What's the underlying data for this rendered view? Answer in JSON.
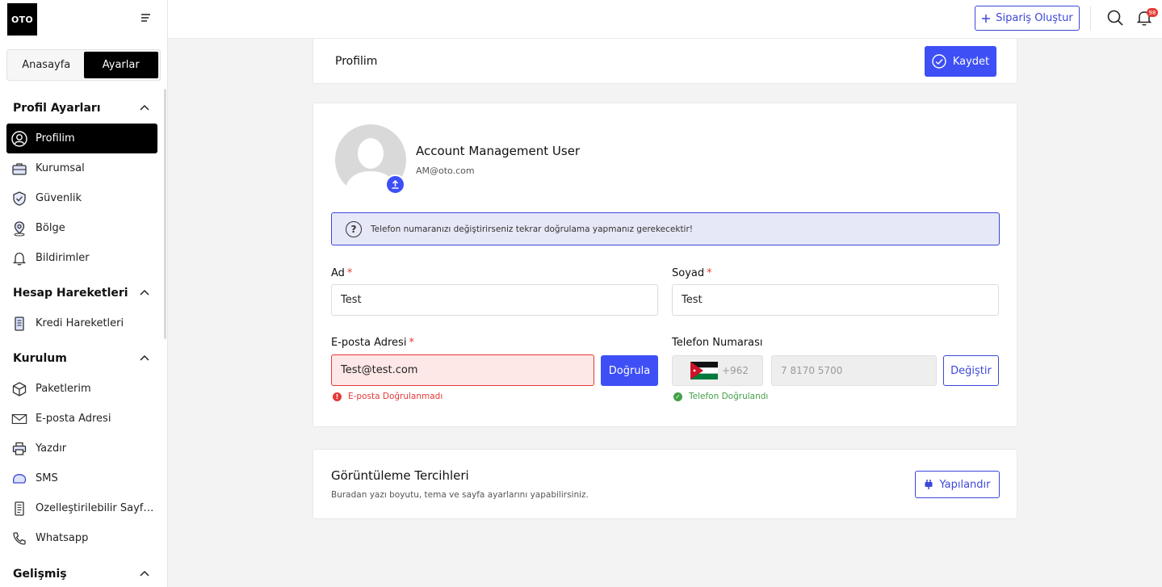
{
  "app": {
    "logo_text": "OTO"
  },
  "segment": {
    "home": "Anasayfa",
    "settings": "Ayarlar"
  },
  "sidebar": {
    "sections": [
      {
        "title": "Profil Ayarları"
      },
      {
        "title": "Hesap Hareketleri"
      },
      {
        "title": "Kurulum"
      },
      {
        "title": "Gelişmiş"
      }
    ],
    "items": [
      {
        "label": "Profilim",
        "icon": "user-circle-icon"
      },
      {
        "label": "Kurumsal",
        "icon": "briefcase-icon"
      },
      {
        "label": "Güvenlik",
        "icon": "shield-icon"
      },
      {
        "label": "Bölge",
        "icon": "location-pin-icon"
      },
      {
        "label": "Bildirimler",
        "icon": "bell-icon"
      },
      {
        "label": "Kredi Hareketleri",
        "icon": "receipt-icon"
      },
      {
        "label": "Paketlerim",
        "icon": "package-icon"
      },
      {
        "label": "E-posta Adresi",
        "icon": "envelope-icon"
      },
      {
        "label": "Yazdır",
        "icon": "printer-icon"
      },
      {
        "label": "SMS",
        "icon": "sms-icon"
      },
      {
        "label": "Özelleştirilebilir Sayfa...",
        "icon": "page-icon"
      },
      {
        "label": "Whatsapp",
        "icon": "phone-icon"
      }
    ]
  },
  "topbar": {
    "create_order": "Sipariş Oluştur",
    "notification_count": "98"
  },
  "header": {
    "title": "Profilim",
    "save": "Kaydet"
  },
  "profile": {
    "name": "Account Management User",
    "email": "AM@oto.com",
    "info": "Telefon numaranızı değiştirirseniz tekrar doğrulama yapmanız gerekecektir!",
    "first_name": {
      "label": "Ad",
      "required": "*",
      "value": "Test"
    },
    "last_name": {
      "label": "Soyad",
      "required": "*",
      "value": "Test"
    },
    "email_field": {
      "label": "E-posta Adresi",
      "required": "*",
      "value": "Test@test.com",
      "error": "E-posta Doğrulanmadı",
      "verify": "Doğrula"
    },
    "phone": {
      "label": "Telefon Numarası",
      "code": "+962",
      "number": "7 8170 5700",
      "status": "Telefon Doğrulandı",
      "change": "Değiştir"
    }
  },
  "display": {
    "title": "Görüntüleme Tercihleri",
    "subtitle": "Buradan yazı boyutu, tema ve sayfa ayarlarını yapabilirsiniz.",
    "configure": "Yapılandır"
  },
  "colors": {
    "accent": "#3d4ff5",
    "error": "#e53935",
    "success": "#43a047"
  }
}
